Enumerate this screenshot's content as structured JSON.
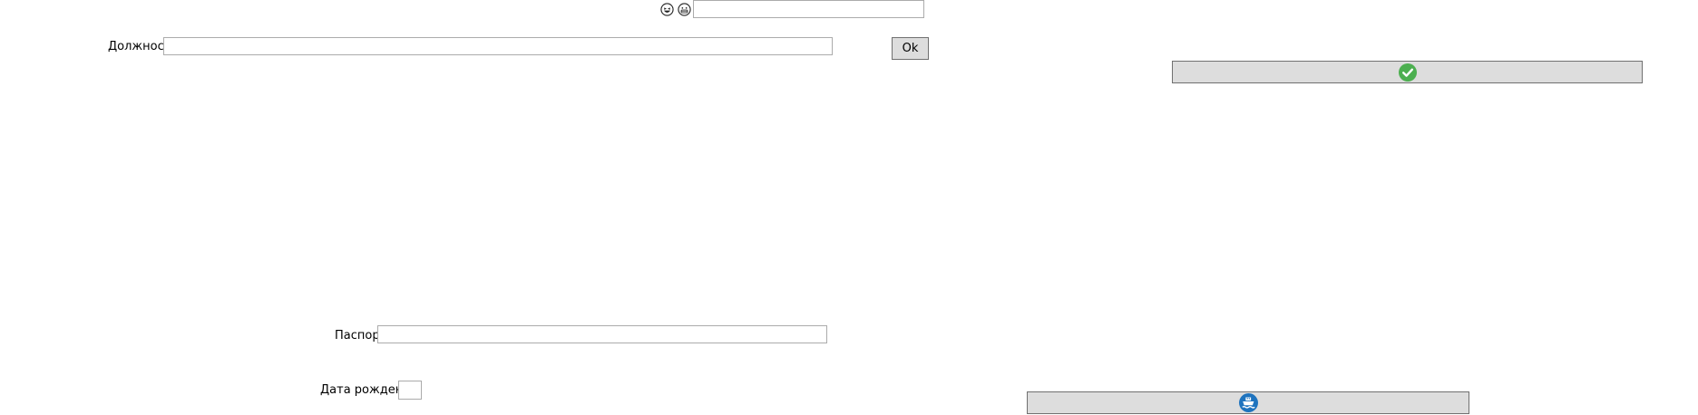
{
  "top": {
    "smiley_left_icon": "laughing-face-icon",
    "smiley_right_icon": "grinning-face-icon",
    "search_value": "",
    "search_placeholder": ""
  },
  "form": {
    "position_label": "Должность",
    "position_value": "",
    "ok_label": "Ok",
    "passport_label": "Паспорт",
    "passport_value": "",
    "birthdate_label": "Дата рождения",
    "birthdate_value": ""
  },
  "buttons": {
    "confirm_icon": "checkmark-circle-icon",
    "confirm_color": "#4caf50",
    "bottom_icon": "ship-icon",
    "bottom_color": "#1e73be"
  }
}
